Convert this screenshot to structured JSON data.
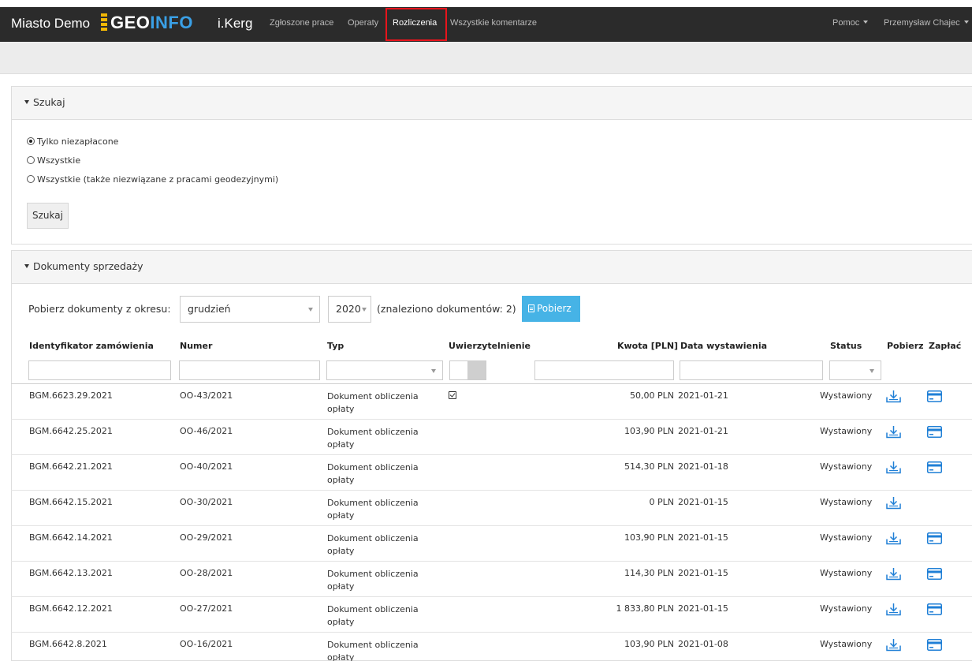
{
  "navbar": {
    "city": "Miasto Demo",
    "logo_geo": "GEO",
    "logo_info": "INFO",
    "app": "i.Kerg",
    "items": [
      "Zgłoszone prace",
      "Operaty",
      "Rozliczenia",
      "Wszystkie komentarze"
    ],
    "active": "Rozliczenia",
    "help": "Pomoc",
    "user": "Przemysław Chajec"
  },
  "search_panel": {
    "title": "Szukaj",
    "options": [
      "Tylko niezapłacone",
      "Wszystkie",
      "Wszystkie (także niezwiązane z pracami geodezyjnymi)"
    ],
    "selected": "Tylko niezapłacone",
    "button": "Szukaj"
  },
  "docs_panel": {
    "title": "Dokumenty sprzedaży",
    "period_label": "Pobierz dokumenty z okresu:",
    "month": "grudzień",
    "year": "2020",
    "found_text": "(znaleziono dokumentów: 2)",
    "download_button": "Pobierz",
    "columns": [
      "Identyfikator zamówienia",
      "Numer",
      "Typ",
      "Uwierzytelnienie",
      "Kwota [PLN]",
      "Data wystawienia",
      "Status",
      "Pobierz",
      "Zapłać"
    ],
    "rows": [
      {
        "id": "BGM.6623.29.2021",
        "numer": "OO-43/2021",
        "typ": "Dokument obliczenia opłaty",
        "auth": true,
        "kwota": "50,00 PLN",
        "data": "2021-01-21",
        "status": "Wystawiony",
        "payable": true
      },
      {
        "id": "BGM.6642.25.2021",
        "numer": "OO-46/2021",
        "typ": "Dokument obliczenia opłaty",
        "auth": false,
        "kwota": "103,90 PLN",
        "data": "2021-01-21",
        "status": "Wystawiony",
        "payable": true
      },
      {
        "id": "BGM.6642.21.2021",
        "numer": "OO-40/2021",
        "typ": "Dokument obliczenia opłaty",
        "auth": false,
        "kwota": "514,30 PLN",
        "data": "2021-01-18",
        "status": "Wystawiony",
        "payable": true
      },
      {
        "id": "BGM.6642.15.2021",
        "numer": "OO-30/2021",
        "typ": "Dokument obliczenia opłaty",
        "auth": false,
        "kwota": "0 PLN",
        "data": "2021-01-15",
        "status": "Wystawiony",
        "payable": false
      },
      {
        "id": "BGM.6642.14.2021",
        "numer": "OO-29/2021",
        "typ": "Dokument obliczenia opłaty",
        "auth": false,
        "kwota": "103,90 PLN",
        "data": "2021-01-15",
        "status": "Wystawiony",
        "payable": true
      },
      {
        "id": "BGM.6642.13.2021",
        "numer": "OO-28/2021",
        "typ": "Dokument obliczenia opłaty",
        "auth": false,
        "kwota": "114,30 PLN",
        "data": "2021-01-15",
        "status": "Wystawiony",
        "payable": true
      },
      {
        "id": "BGM.6642.12.2021",
        "numer": "OO-27/2021",
        "typ": "Dokument obliczenia opłaty",
        "auth": false,
        "kwota": "1 833,80 PLN",
        "data": "2021-01-15",
        "status": "Wystawiony",
        "payable": true
      },
      {
        "id": "BGM.6642.8.2021",
        "numer": "OO-16/2021",
        "typ": "Dokument obliczenia opłaty",
        "auth": false,
        "kwota": "103,90 PLN",
        "data": "2021-01-08",
        "status": "Wystawiony",
        "payable": true
      }
    ]
  },
  "colors": {
    "navbar_bg": "#2b2b2b",
    "logo_accent": "#3aa0e6",
    "logo_bars": "#f2b705",
    "highlight": "#e8141c",
    "primary_button": "#46b3e6",
    "icon_blue": "#1f7fd6"
  },
  "icons": {
    "download": "download-icon",
    "pay": "credit-card-icon",
    "download_button": "document-icon"
  }
}
